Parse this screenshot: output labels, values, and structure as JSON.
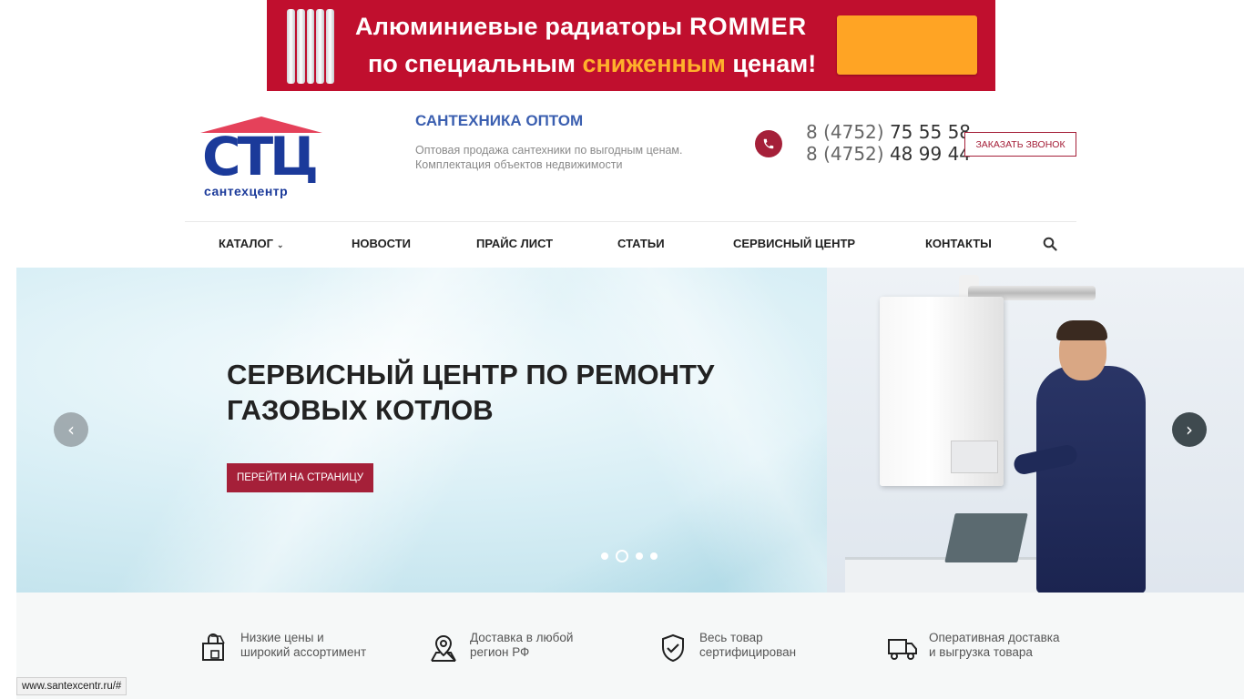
{
  "banner": {
    "line1_prefix": "Алюминиевые радиаторы",
    "brand": "ROMMER",
    "line2_prefix": "по специальным",
    "line2_highlight": "сниженным",
    "line2_suffix": "ценам!",
    "colors": {
      "background": "#c00f2e",
      "highlight": "#ffb12b",
      "cta": "#ffa424"
    }
  },
  "header": {
    "logo_letters": "СТЦ",
    "logo_subtitle": "сантехцентр",
    "title": "САНТЕХНИКА ОПТОМ",
    "description_line1": "Оптовая продажа сантехники по выгодным ценам.",
    "description_line2": "Комплектация объектов недвижимости",
    "phone_icon": "phone-icon",
    "phones": [
      {
        "code": "8 (4752)",
        "number": "75 55 58"
      },
      {
        "code": "8 (4752)",
        "number": "48 99 44"
      }
    ],
    "callback_label": "ЗАКАЗАТЬ ЗВОНОК",
    "accent_color": "#a52039"
  },
  "nav": {
    "items": [
      {
        "label": "КАТАЛОГ",
        "has_dropdown": true
      },
      {
        "label": "НОВОСТИ"
      },
      {
        "label": "ПРАЙС ЛИСТ"
      },
      {
        "label": "СТАТЬИ"
      },
      {
        "label": "СЕРВИСНЫЙ ЦЕНТР"
      },
      {
        "label": "КОНТАКТЫ"
      }
    ],
    "search_icon": "search-icon"
  },
  "slider": {
    "title_line1": "СЕРВИСНЫЙ ЦЕНТР ПО РЕМОНТУ",
    "title_line2": "ГАЗОВЫХ КОТЛОВ",
    "button_label": "ПЕРЕЙТИ НА СТРАНИЦУ",
    "prev_symbol": "‹",
    "next_symbol": "›",
    "slide_count": 4,
    "active_slide": 2
  },
  "features": [
    {
      "icon": "shopping-bag-icon",
      "line1": "Низкие цены и",
      "line2": "широкий ассортимент"
    },
    {
      "icon": "map-pin-icon",
      "line1": "Доставка в любой",
      "line2": "регион РФ"
    },
    {
      "icon": "shield-check-icon",
      "line1": "Весь товар",
      "line2": "сертифицирован"
    },
    {
      "icon": "truck-icon",
      "line1": "Оперативная доставка",
      "line2": "и выгрузка товара"
    }
  ],
  "status_bar": {
    "url": "www.santexcentr.ru/#"
  }
}
